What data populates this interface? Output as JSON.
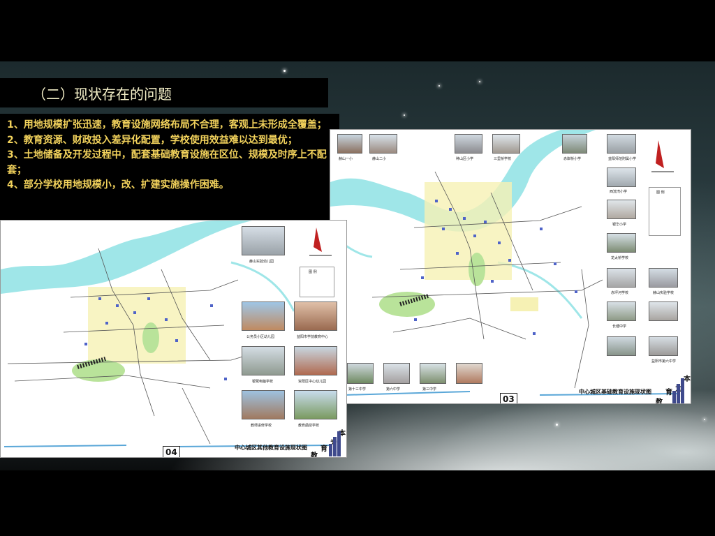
{
  "slide": {
    "title": "（二）现状存在的问题",
    "issues": [
      "1、用地规模扩张迅速，教育设施网络布局不合理，客观上未形成全覆盖；",
      "2、教育资源、财政投入差异化配置，学校使用效益难以达到最优；",
      "3、土地储备及开发过程中，配套基础教育设施在区位、规模及时序上不配套；",
      "4、部分学校用地规模小，改、扩建实施操作困难。"
    ]
  },
  "map_03": {
    "title": "中心城区基础教育设施现状图",
    "page": "03",
    "corner_chars": [
      "本",
      "为",
      "育",
      "教"
    ],
    "photo_captions": [
      "赫山一小",
      "赫山二小",
      "种山区小学",
      "三里桥学校",
      "赤岸桥小学",
      "益阳师范附属小学",
      "西流湾小学",
      "银华小学",
      "龙太桥学校",
      "赤坪河学校",
      "赫山实验学校",
      "长塘中学",
      "第十三中学",
      "第六中学",
      "第三中学",
      "益阳市第六中学"
    ],
    "legend_title": "图 例"
  },
  "map_04": {
    "title": "中心城区其他教育设施现状图",
    "page": "04",
    "corner_chars": [
      "本",
      "为",
      "育",
      "教"
    ],
    "photo_captions": [
      "赫山实验幼儿园",
      "公务员小区幼儿园",
      "益阳市学前教育中心",
      "银鹭电脑学校",
      "资阳区中心幼儿园",
      "教师进修学校",
      "教育函授学校"
    ],
    "legend_title": "图 例"
  },
  "colors": {
    "title_text": "#f4f0c8",
    "issue_text": "#f2d25c",
    "river": "#9fe6e8",
    "road": "#4f63c8",
    "green": "#b9e39a",
    "school_zone": "#f6f1b4"
  }
}
